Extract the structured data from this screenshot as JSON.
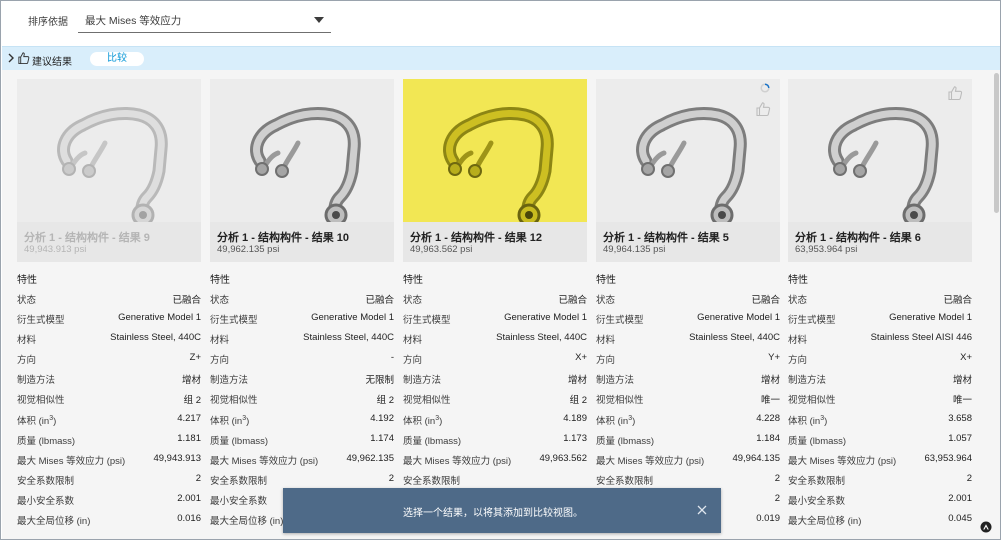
{
  "sort": {
    "label": "排序依据",
    "value": "最大 Mises 等效应力"
  },
  "band": {
    "title": "建议结果",
    "compare_label": "比较"
  },
  "columns": [
    {
      "name": "分析 1 - 结构构件 - 结果 9",
      "stress": "49,943.913 psi",
      "section": "特性",
      "props": [
        {
          "k": "状态",
          "v": "已融合"
        },
        {
          "k": "衍生式模型",
          "v": "Generative Model 1"
        },
        {
          "k": "材料",
          "v": "Stainless Steel, 440C"
        },
        {
          "k": "方向",
          "v": "Z+"
        },
        {
          "k": "制造方法",
          "v": "增材"
        },
        {
          "k": "视觉相似性",
          "v": "组 2"
        },
        {
          "k": "体积 (in",
          "v": "4.217"
        },
        {
          "k": "质量 (lbmass)",
          "v": "1.181"
        },
        {
          "k": "最大 Mises 等效应力 (psi)",
          "v": "49,943.913"
        },
        {
          "k": "安全系数限制",
          "v": "2"
        },
        {
          "k": "最小安全系数",
          "v": "2.001"
        },
        {
          "k": "最大全局位移 (in)",
          "v": "0.016"
        }
      ]
    },
    {
      "name": "分析 1 - 结构构件 - 结果 10",
      "stress": "49,962.135 psi",
      "section": "特性",
      "props": [
        {
          "k": "状态",
          "v": "已融合"
        },
        {
          "k": "衍生式模型",
          "v": "Generative Model 1"
        },
        {
          "k": "材料",
          "v": "Stainless Steel, 440C"
        },
        {
          "k": "方向",
          "v": "-"
        },
        {
          "k": "制造方法",
          "v": "无限制"
        },
        {
          "k": "视觉相似性",
          "v": "组 2"
        },
        {
          "k": "体积 (in",
          "v": "4.192"
        },
        {
          "k": "质量 (lbmass)",
          "v": "1.174"
        },
        {
          "k": "最大 Mises 等效应力 (psi)",
          "v": "49,962.135"
        },
        {
          "k": "安全系数限制",
          "v": "2"
        },
        {
          "k": "最小安全系数",
          "v": ""
        },
        {
          "k": "最大全局位移 (in)",
          "v": ""
        }
      ]
    },
    {
      "name": "分析 1 - 结构构件 - 结果 12",
      "stress": "49,963.562 psi",
      "section": "特性",
      "props": [
        {
          "k": "状态",
          "v": "已融合"
        },
        {
          "k": "衍生式模型",
          "v": "Generative Model 1"
        },
        {
          "k": "材料",
          "v": "Stainless Steel, 440C"
        },
        {
          "k": "方向",
          "v": "X+"
        },
        {
          "k": "制造方法",
          "v": "增材"
        },
        {
          "k": "视觉相似性",
          "v": "组 2"
        },
        {
          "k": "体积 (in",
          "v": "4.189"
        },
        {
          "k": "质量 (lbmass)",
          "v": "1.173"
        },
        {
          "k": "最大 Mises 等效应力 (psi)",
          "v": "49,963.562"
        },
        {
          "k": "安全系数限制",
          "v": ""
        },
        {
          "k": "最小安全系数",
          "v": ""
        },
        {
          "k": "最大全局位移 (in)",
          "v": ""
        }
      ]
    },
    {
      "name": "分析 1 - 结构构件 - 结果 5",
      "stress": "49,964.135 psi",
      "section": "特性",
      "props": [
        {
          "k": "状态",
          "v": "已融合"
        },
        {
          "k": "衍生式模型",
          "v": "Generative Model 1"
        },
        {
          "k": "材料",
          "v": "Stainless Steel, 440C"
        },
        {
          "k": "方向",
          "v": "Y+"
        },
        {
          "k": "制造方法",
          "v": "增材"
        },
        {
          "k": "视觉相似性",
          "v": "唯一"
        },
        {
          "k": "体积 (in",
          "v": "4.228"
        },
        {
          "k": "质量 (lbmass)",
          "v": "1.184"
        },
        {
          "k": "最大 Mises 等效应力 (psi)",
          "v": "49,964.135"
        },
        {
          "k": "安全系数限制",
          "v": "2"
        },
        {
          "k": "最小安全系数",
          "v": "2"
        },
        {
          "k": "最大全局位移 (in)",
          "v": "0.019"
        }
      ]
    },
    {
      "name": "分析 1 - 结构构件 - 结果 6",
      "stress": "63,953.964 psi",
      "section": "特性",
      "props": [
        {
          "k": "状态",
          "v": "已融合"
        },
        {
          "k": "衍生式模型",
          "v": "Generative Model 1"
        },
        {
          "k": "材料",
          "v": "Stainless Steel AISI 446"
        },
        {
          "k": "方向",
          "v": "X+"
        },
        {
          "k": "制造方法",
          "v": "增材"
        },
        {
          "k": "视觉相似性",
          "v": "唯一"
        },
        {
          "k": "体积 (in",
          "v": "3.658"
        },
        {
          "k": "质量 (lbmass)",
          "v": "1.057"
        },
        {
          "k": "最大 Mises 等效应力 (psi)",
          "v": "63,953.964"
        },
        {
          "k": "安全系数限制",
          "v": "2"
        },
        {
          "k": "最小安全系数",
          "v": "2.001"
        },
        {
          "k": "最大全局位移 (in)",
          "v": "0.045"
        }
      ]
    }
  ],
  "volume_unit_suffix": "3)",
  "toast": {
    "message": "选择一个结果，以将其添加到比较视图。"
  },
  "colors": {
    "band": "#d9eefb",
    "accent": "#0696d7",
    "highlight": "#f2e754",
    "toast": "#4e6a88"
  },
  "icons": [
    "chevron-right-icon",
    "thumbs-up-icon",
    "close-icon",
    "loading-icon",
    "help-icon",
    "caret-down-icon"
  ]
}
